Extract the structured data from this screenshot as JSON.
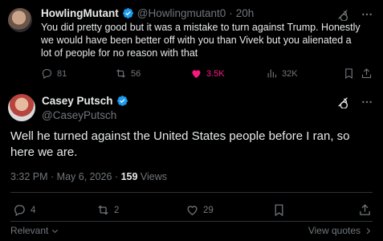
{
  "reply": {
    "name": "HowlingMutant",
    "handle": "@Howlingmutant0",
    "time": "20h",
    "separator": "·",
    "text": "You did pretty good but it was a mistake to turn against Trump.  Honestly we would have been better off with you than Vivek but you alienated a lot of people for no reason with that",
    "stats": {
      "replies": "81",
      "reposts": "56",
      "likes": "3.5K",
      "views": "32K"
    },
    "like_color": "#f91880"
  },
  "main": {
    "name": "Casey Putsch",
    "handle": "@CaseyPutsch",
    "text": "Well he turned against the United States people before I ran, so here we are.",
    "timestamp": "3:32 PM · May 6, 2026 · ",
    "views_count": "159",
    "views_label": " Views",
    "stats": {
      "replies": "4",
      "reposts": "2",
      "likes": "29"
    }
  },
  "footer": {
    "sort_label": "Relevant",
    "view_quotes": "View quotes"
  },
  "colors": {
    "background": "#000000",
    "text": "#e7e9ea",
    "muted": "#71767b",
    "verified": "#1d9bf0",
    "divider": "#2f3336"
  },
  "icons": [
    "verified-badge-icon",
    "grok-icon",
    "more-icon",
    "reply-icon",
    "repost-icon",
    "like-icon",
    "views-icon",
    "bookmark-icon",
    "share-icon",
    "chevron-down-icon",
    "chevron-right-icon"
  ]
}
